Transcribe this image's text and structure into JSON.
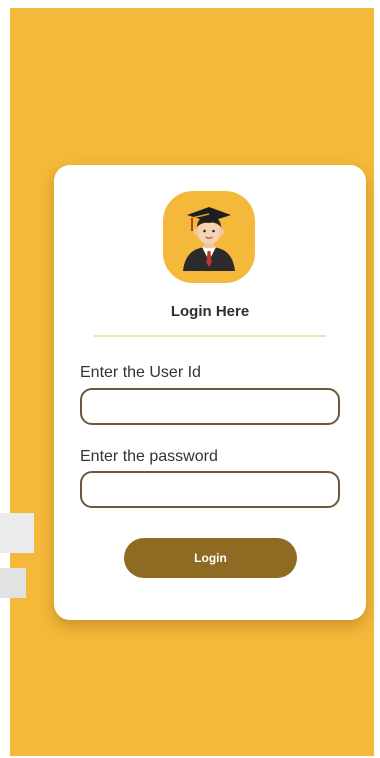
{
  "login": {
    "title": "Login Here",
    "user_id_label": "Enter the User Id",
    "user_id_value": "",
    "password_label": "Enter the password",
    "password_value": "",
    "button_label": "Login"
  },
  "icons": {
    "avatar": "graduate-student-icon"
  },
  "colors": {
    "background": "#f4b83a",
    "card": "#ffffff",
    "button": "#8f6a23",
    "field_border": "#6b5a3a"
  }
}
